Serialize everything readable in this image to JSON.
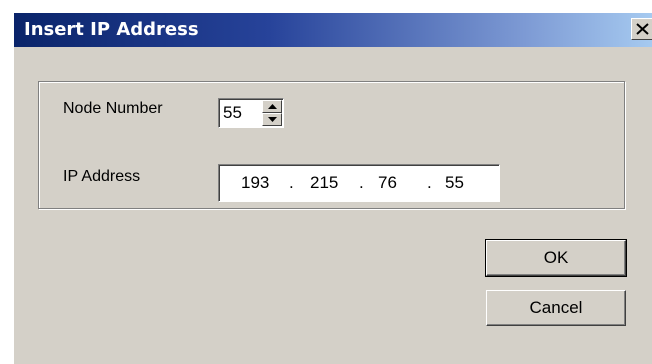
{
  "dialog": {
    "title": "Insert IP Address",
    "close_glyph": "✕"
  },
  "form": {
    "node_number_label": "Node Number",
    "node_number_value": "55",
    "ip_address_label": "IP Address",
    "ip_octets": [
      "193",
      "215",
      "76",
      "55"
    ],
    "ip_separator": "."
  },
  "buttons": {
    "ok_label": "OK",
    "cancel_label": "Cancel"
  },
  "icons": {
    "close": "close-icon",
    "spin_up": "spin-up-arrow-icon",
    "spin_down": "spin-down-arrow-icon"
  },
  "colors": {
    "title_bar_start": "#0a246a",
    "title_bar_end": "#a6caf0",
    "dialog_face": "#d4d0c8"
  }
}
